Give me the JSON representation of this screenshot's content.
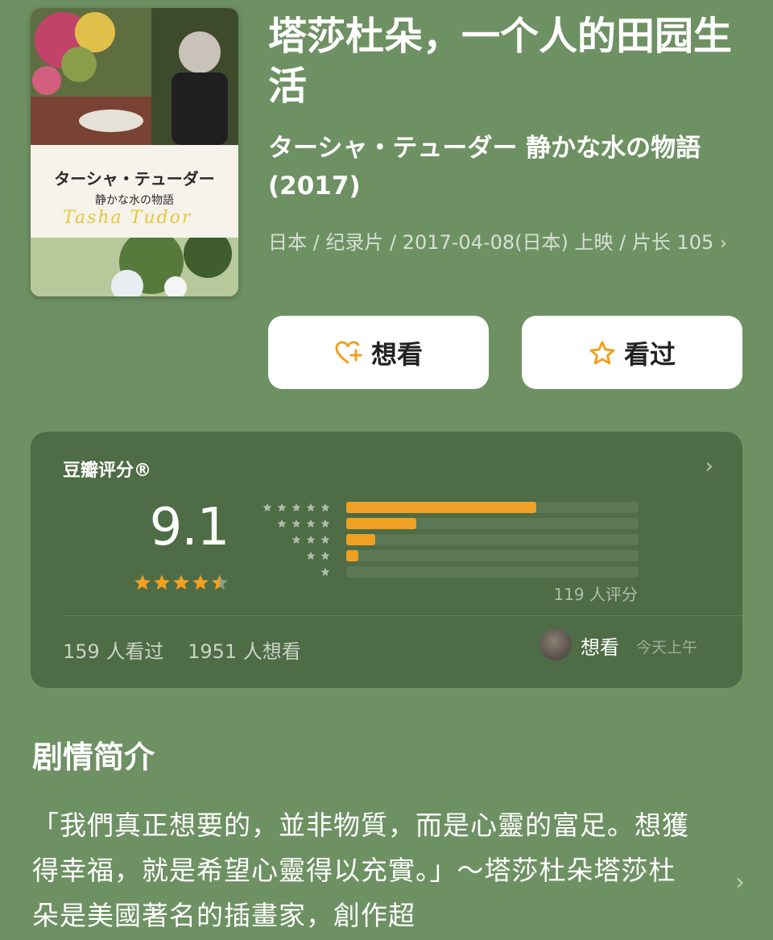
{
  "movie": {
    "title": "塔莎杜朵，一个人的田园生活",
    "original_title": "ターシャ・テューダー 静かな水の物語 (2017)",
    "meta": "日本 / 纪录片 / 2017-04-08(日本) 上映 / 片长 105",
    "meta_chevron": "›",
    "poster": {
      "title_jp": "ターシャ・テューダー",
      "subtitle_jp": "静かな水の物語",
      "script_name": "Tasha Tudor"
    }
  },
  "actions": {
    "want_label": "想看",
    "seen_label": "看过"
  },
  "rating": {
    "card_title": "豆瓣评分®",
    "chevron": "›",
    "score": "9.1",
    "stars_value": 4.5,
    "distribution": [
      {
        "stars": 5,
        "fraction": 0.65
      },
      {
        "stars": 4,
        "fraction": 0.24
      },
      {
        "stars": 3,
        "fraction": 0.1
      },
      {
        "stars": 2,
        "fraction": 0.04
      },
      {
        "stars": 1,
        "fraction": 0.0
      }
    ],
    "count_text": "119 人评分",
    "seen_count": "159 人看过",
    "want_count": "1951 人想看",
    "friend_status": "想看",
    "friend_time": "今天上午"
  },
  "synopsis": {
    "heading": "剧情简介",
    "text": "「我們真正想要的，並非物質，而是心靈的富足。想獲得幸福，就是希望心靈得以充實。」～塔莎杜朵塔莎杜朵是美國著名的插畫家，創作超",
    "chevron": "›"
  },
  "colors": {
    "background": "#6e9163",
    "card": "#4e6c45",
    "accent": "#f0a022",
    "button_bg": "#ffffff"
  },
  "icons": [
    "heart-plus-icon",
    "star-outline-icon",
    "chevron-right-icon",
    "star-icon"
  ]
}
